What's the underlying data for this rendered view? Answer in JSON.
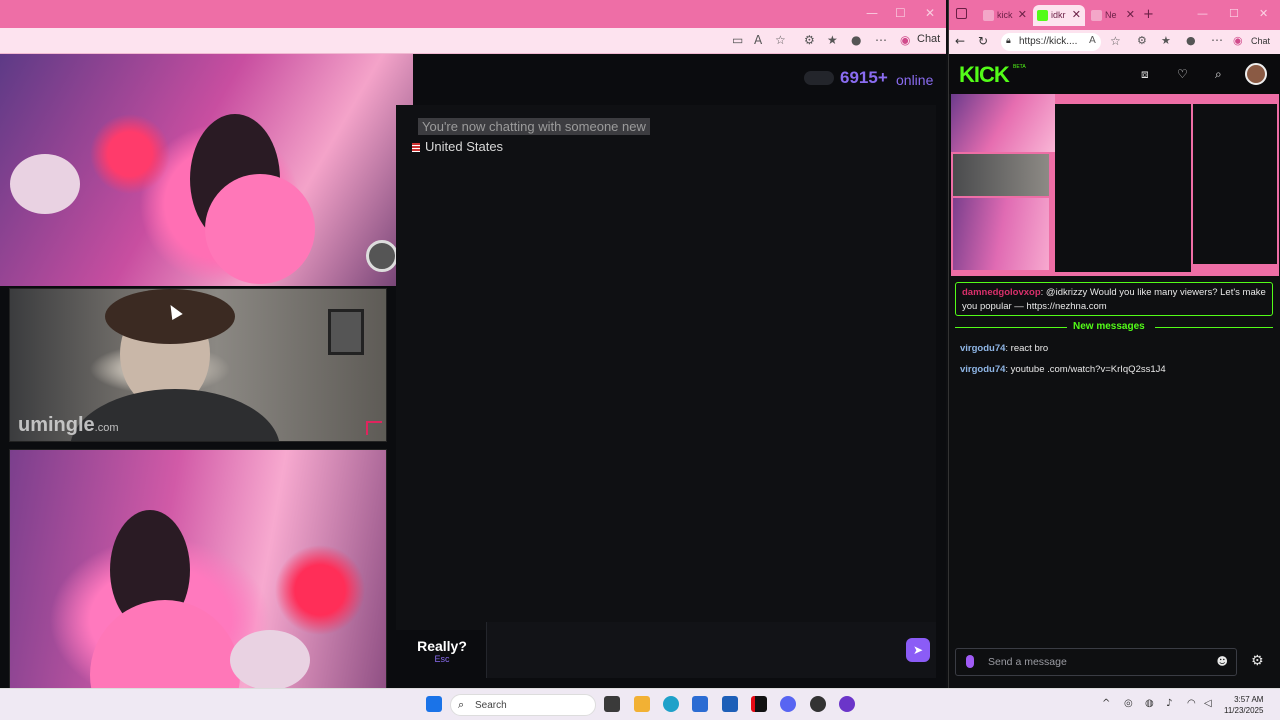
{
  "left_window": {
    "chat_button": "Chat",
    "online": {
      "count": "6915+",
      "label": "online"
    },
    "system_messages": [
      "You're now chatting with someone new",
      "United States"
    ],
    "really_button": {
      "label": "Really?",
      "hint": "Esc"
    },
    "watermark": {
      "brand": "umingle",
      "tld": ".com"
    }
  },
  "right_window": {
    "tabs": [
      {
        "label": "kick",
        "icon_color": "#ee6ea6",
        "active": false
      },
      {
        "label": "idkr",
        "icon_color": "#53fc18",
        "active": true
      },
      {
        "label": "Ne",
        "icon_color": "#ee6ea6",
        "active": false
      }
    ],
    "url": "https://kick....",
    "chat_button": "Chat",
    "logo": "KICK",
    "logo_badge": "BETA",
    "chat": {
      "highlight": {
        "user": "damnedgolovxop",
        "text": ": @idkrizzy Would you like many viewers? Let's make you popular — https://nezhna.com"
      },
      "divider": "New messages",
      "messages": [
        {
          "user": "virgodu74",
          "text": ": react bro"
        },
        {
          "user": "virgodu74",
          "text": ": youtube .com/watch?v=KrIqQ2ss1J4"
        }
      ],
      "input_placeholder": "Send a message"
    }
  },
  "taskbar": {
    "search_label": "Search",
    "time": "3:57 AM",
    "date": "11/23/2025"
  },
  "colors": {
    "accent_pink": "#ee6ea6",
    "kick_green": "#53fc18",
    "online_purple": "#8a6cf0",
    "send_purple": "#8b5cf6"
  }
}
